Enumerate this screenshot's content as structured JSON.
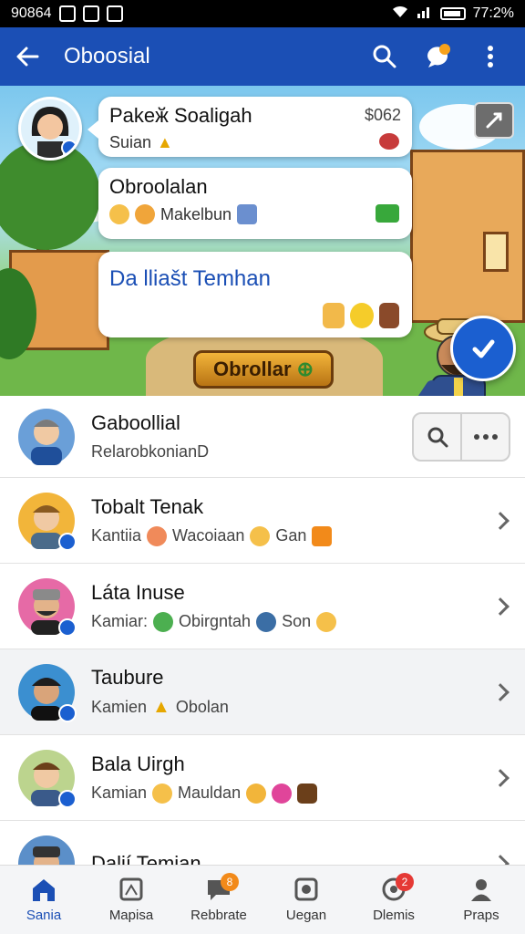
{
  "status_bar": {
    "time_left": "90864",
    "time_right": "77:2%"
  },
  "app_bar": {
    "title": "Oboosial"
  },
  "hero": {
    "bubble1": {
      "title": "Pakeӂ Soaligah",
      "subtitle": "Suian",
      "price": "$062"
    },
    "bubble2": {
      "title": "Obroolalan",
      "subtitle": "Makelbun"
    },
    "bubble3": {
      "title": "Da lliašt Temhan"
    },
    "chat_button": "Obrollar"
  },
  "contacts": [
    {
      "name": "Gaboollial",
      "sub": "RelarobkonianD",
      "avatar_color": "#6a9fd8"
    },
    {
      "name": "Tobalt Tenak",
      "sub_parts": [
        "Kantiia",
        "Wacoiaan",
        "Gan"
      ],
      "avatar_color": "#f2b53a"
    },
    {
      "name": "Láta Inuse",
      "sub_parts": [
        "Kamiar:",
        "Obirgntah",
        "Son"
      ],
      "avatar_color": "#e66aa6"
    },
    {
      "name": "Taubure",
      "sub_parts": [
        "Kamien",
        "Obolan"
      ],
      "avatar_color": "#3b8fd0"
    },
    {
      "name": "Bala Uirgh",
      "sub_parts": [
        "Kamian",
        "Mauldan"
      ],
      "avatar_color": "#bcd48e"
    },
    {
      "name": "Dalií Temian",
      "sub_parts": [],
      "avatar_color": "#5b8fc9"
    }
  ],
  "bottom_nav": [
    {
      "label": "Sania",
      "badge": ""
    },
    {
      "label": "Mapisa",
      "badge": ""
    },
    {
      "label": "Rebbrate",
      "badge": "8"
    },
    {
      "label": "Uegan",
      "badge": ""
    },
    {
      "label": "Dlemis",
      "badge": "2"
    },
    {
      "label": "Praps",
      "badge": ""
    }
  ],
  "colors": {
    "primary": "#1b4fb5",
    "accent": "#f7a21b",
    "badge_red": "#e53935"
  }
}
